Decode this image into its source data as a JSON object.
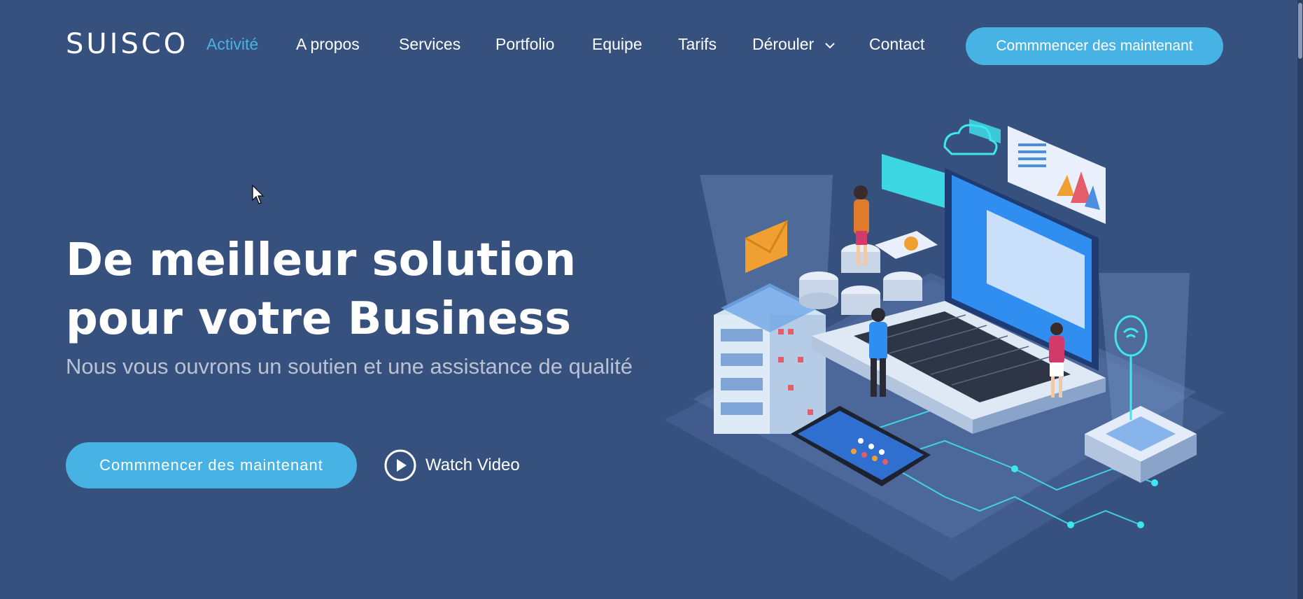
{
  "header": {
    "logo": "SUISCO",
    "nav": [
      {
        "label": "Activité",
        "active": true
      },
      {
        "label": "A propos"
      },
      {
        "label": "Services"
      },
      {
        "label": "Portfolio"
      },
      {
        "label": "Equipe"
      },
      {
        "label": "Tarifs"
      },
      {
        "label": "Dérouler",
        "dropdown": true
      },
      {
        "label": "Contact"
      }
    ],
    "cta": "Commmencer des maintenant"
  },
  "hero": {
    "title_line1": "De meilleur solution",
    "title_line2": "pour votre Business",
    "subtitle": "Nous vous ouvrons un soutien et une assistance de qualité",
    "cta": "Commmencer des maintenant",
    "watch_video": "Watch Video"
  },
  "colors": {
    "background": "#37517e",
    "accent": "#47b2e4"
  }
}
